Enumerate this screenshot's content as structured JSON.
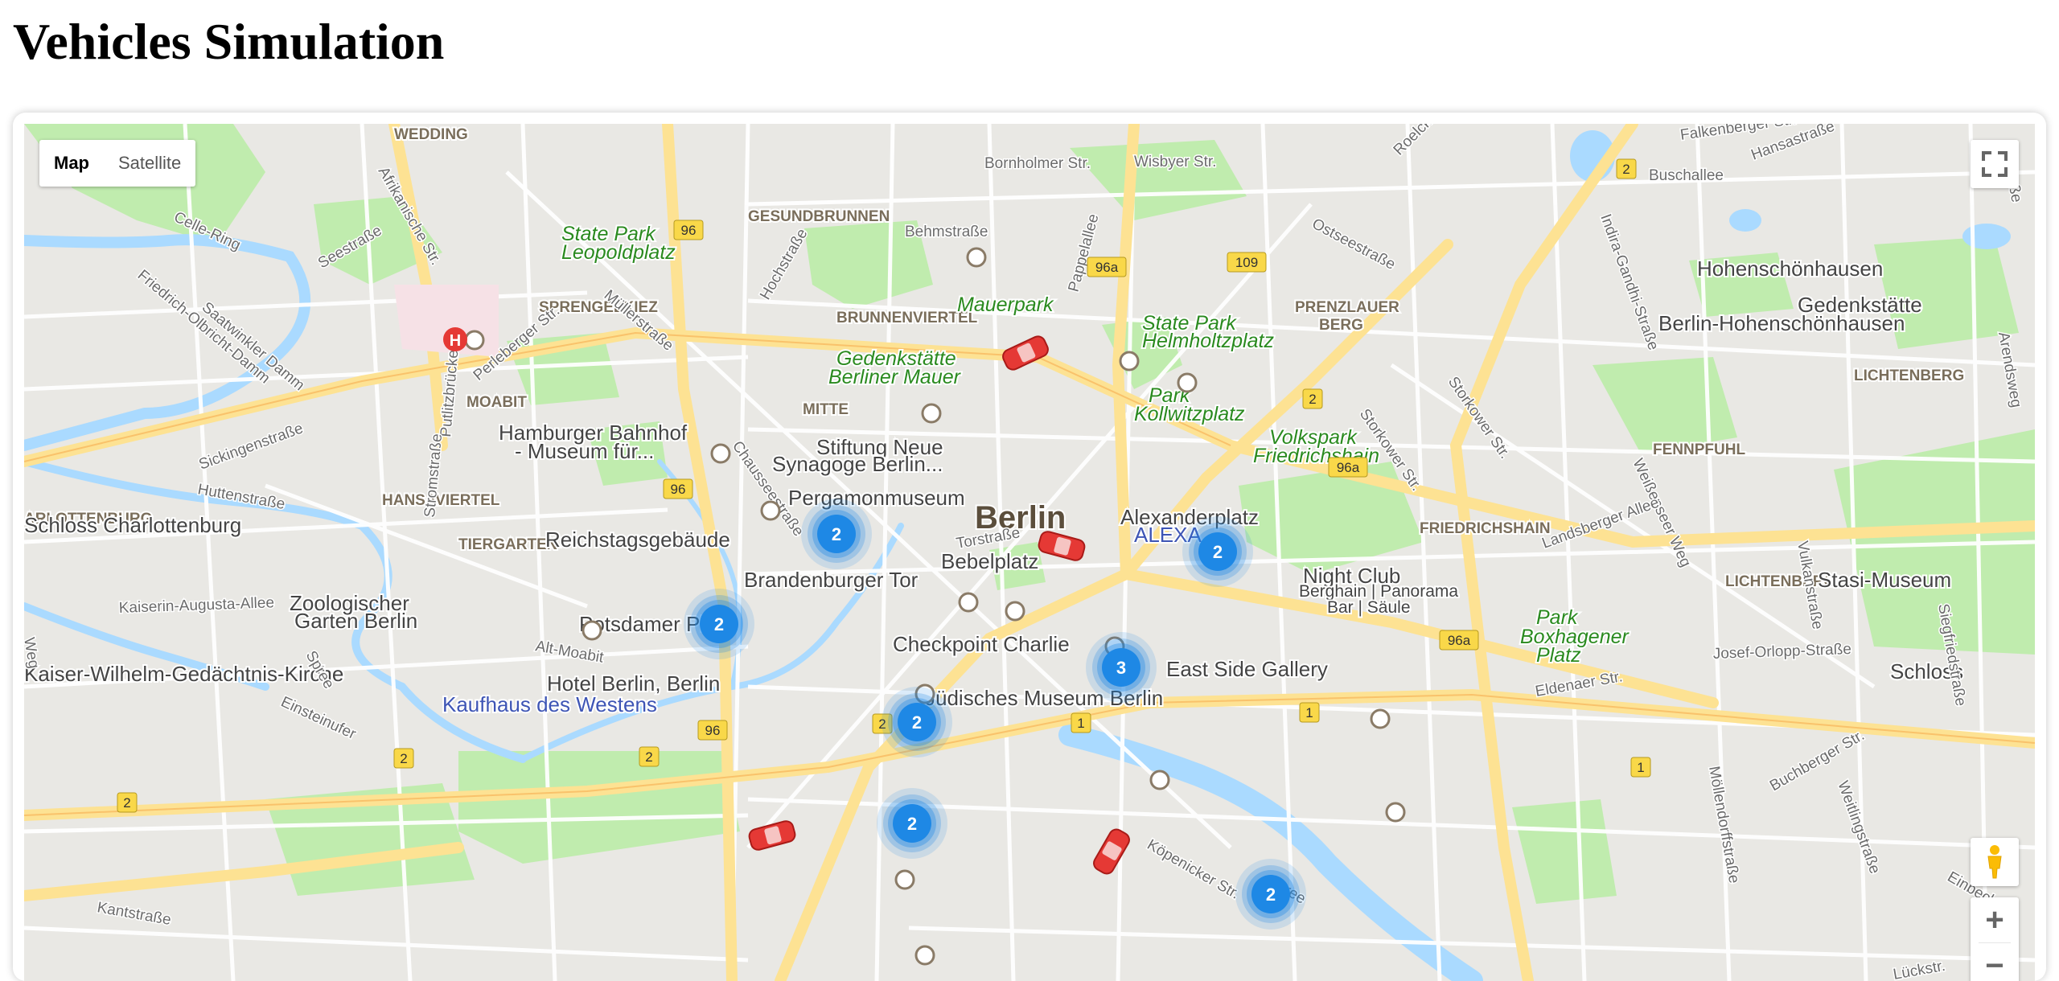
{
  "page": {
    "title": "Vehicles Simulation"
  },
  "map": {
    "type_buttons": [
      "Map",
      "Satellite"
    ],
    "active_type": "Map",
    "place_labels": [
      {
        "text": "WEDDING",
        "cls": "district"
      },
      {
        "text": "GESUNDBRUNNEN",
        "cls": "district"
      },
      {
        "text": "SPRENGELKIEZ",
        "cls": "district"
      },
      {
        "text": "BRUNNENVIERTEL",
        "cls": "district"
      },
      {
        "text": "MOABIT",
        "cls": "district"
      },
      {
        "text": "MITTE",
        "cls": "district"
      },
      {
        "text": "HANSAVIERTEL",
        "cls": "district"
      },
      {
        "text": "ARLOTTENBURG",
        "cls": "district"
      },
      {
        "text": "TIERGARTEN",
        "cls": "district"
      },
      {
        "text": "PRENZLAUER",
        "cls": "district"
      },
      {
        "text": "BERG",
        "cls": "district"
      },
      {
        "text": "LICHTENBERG",
        "cls": "district"
      },
      {
        "text": "FENNPFUHL",
        "cls": "district"
      },
      {
        "text": "FRIEDRICHSHAIN",
        "cls": "district"
      },
      {
        "text": "LICHTENBERG",
        "cls": "district"
      },
      {
        "text": "Berlin",
        "cls": "city"
      },
      {
        "text": "State Park",
        "cls": "park"
      },
      {
        "text": "Leopoldplatz",
        "cls": "park"
      },
      {
        "text": "Mauerpark",
        "cls": "park"
      },
      {
        "text": "State Park",
        "cls": "park"
      },
      {
        "text": "Helmholtzplatz",
        "cls": "park"
      },
      {
        "text": "Gedenkstätte",
        "cls": "park"
      },
      {
        "text": "Berliner Mauer",
        "cls": "park"
      },
      {
        "text": "Park",
        "cls": "park"
      },
      {
        "text": "Kollwitzplatz",
        "cls": "park"
      },
      {
        "text": "Volkspark",
        "cls": "park"
      },
      {
        "text": "Friedrichshain",
        "cls": "park"
      },
      {
        "text": "Park",
        "cls": "park"
      },
      {
        "text": "Boxhagener",
        "cls": "park"
      },
      {
        "text": "Platz",
        "cls": "park"
      },
      {
        "text": "Hohenschönhausen",
        "cls": "poi"
      },
      {
        "text": "Gedenkstätte",
        "cls": "poi"
      },
      {
        "text": "Berlin-Hohenschönhausen",
        "cls": "poi"
      },
      {
        "text": "Hamburger Bahnhof",
        "cls": "poi"
      },
      {
        "text": "- Museum für...",
        "cls": "poi"
      },
      {
        "text": "Stiftung Neue",
        "cls": "poi"
      },
      {
        "text": "Synagoge Berlin...",
        "cls": "poi"
      },
      {
        "text": "Pergamonmuseum",
        "cls": "poi"
      },
      {
        "text": "Alexanderplatz",
        "cls": "poi"
      },
      {
        "text": "ALEXA",
        "cls": "shop"
      },
      {
        "text": "Schloss Charlottenburg",
        "cls": "poi"
      },
      {
        "text": "Reichstagsgebäude",
        "cls": "poi"
      },
      {
        "text": "Bebelplatz",
        "cls": "poi"
      },
      {
        "text": "Brandenburger Tor",
        "cls": "poi"
      },
      {
        "text": "Night Club",
        "cls": "poi"
      },
      {
        "text": "Berghain | Panorama",
        "cls": "poi-small"
      },
      {
        "text": "Bar | Säule",
        "cls": "poi-small"
      },
      {
        "text": "Stasi-Museum",
        "cls": "poi"
      },
      {
        "text": "Zoologischer",
        "cls": "poi"
      },
      {
        "text": "Garten Berlin",
        "cls": "poi"
      },
      {
        "text": "Potsdamer Platz",
        "cls": "poi"
      },
      {
        "text": "Checkpoint Charlie",
        "cls": "poi"
      },
      {
        "text": "East Side Gallery",
        "cls": "poi"
      },
      {
        "text": "Kaiser-Wilhelm-Gedächtnis-Kirche",
        "cls": "poi"
      },
      {
        "text": "Hotel Berlin, Berlin",
        "cls": "poi"
      },
      {
        "text": "Kaufhaus des Westens",
        "cls": "shop"
      },
      {
        "text": "Jüdisches Museum Berlin",
        "cls": "poi"
      },
      {
        "text": "Schloss",
        "cls": "poi"
      }
    ],
    "street_labels": [
      "Bornholmer Str.",
      "Wisbyer Str.",
      "Behmstraße",
      "Ostseestraße",
      "Falkenberger Str.",
      "Buschallee",
      "Hansastraße",
      "Roelckestr.",
      "Indira-Gandhi-Straße",
      "Afrikanische Str.",
      "Saatwinkler Damm",
      "Friedrich-Olbricht-Damm",
      "Seestraße",
      "Müllerstraße",
      "Hochstraße",
      "Chausseestraße",
      "Pappelallee",
      "Storkower Str.",
      "Weißenseer Weg",
      "Perleberger Str.",
      "Sickingenstraße",
      "Huttenstraße",
      "Kaiserin-Augusta-Allee",
      "Alt-Moabit",
      "Putlitzbrücke",
      "Stromstraße",
      "Torstraße",
      "Landsberger Allee",
      "Vulkanstraße",
      "Josef-Orlopp-Straße",
      "Siegfriedstraße",
      "Eldenaer Str.",
      "Möllendorffstraße",
      "Einsteinufer",
      "Kantstraße",
      "Köpenicker Str.",
      "Spree",
      "Spree",
      "Buchberger Str.",
      "Weitlingstraße",
      "Lückstr.",
      "Einbeck",
      "Arendsweg",
      "Storkower Str.",
      "Celle-Ring",
      "Weg",
      "damm",
      "raße"
    ],
    "road_shields": [
      "96",
      "96a",
      "109",
      "2",
      "96",
      "2",
      "96a",
      "96a",
      "96",
      "2",
      "2",
      "1",
      "1",
      "2",
      "2",
      "1"
    ],
    "cluster_markers": [
      {
        "count": "2"
      },
      {
        "count": "2"
      },
      {
        "count": "2"
      },
      {
        "count": "3"
      },
      {
        "count": "2"
      },
      {
        "count": "2"
      },
      {
        "count": "2"
      }
    ],
    "vehicles": 4,
    "colors": {
      "cluster": "#1e88e5",
      "vehicle": "#e53935",
      "water": "#aadaff",
      "park": "#c0ecae",
      "major_road": "#fde293",
      "background": "#e9e8e4"
    },
    "controls": {
      "fullscreen": "fullscreen-icon",
      "pegman": "pegman-icon",
      "zoom_in": "+",
      "zoom_out": "−"
    }
  }
}
